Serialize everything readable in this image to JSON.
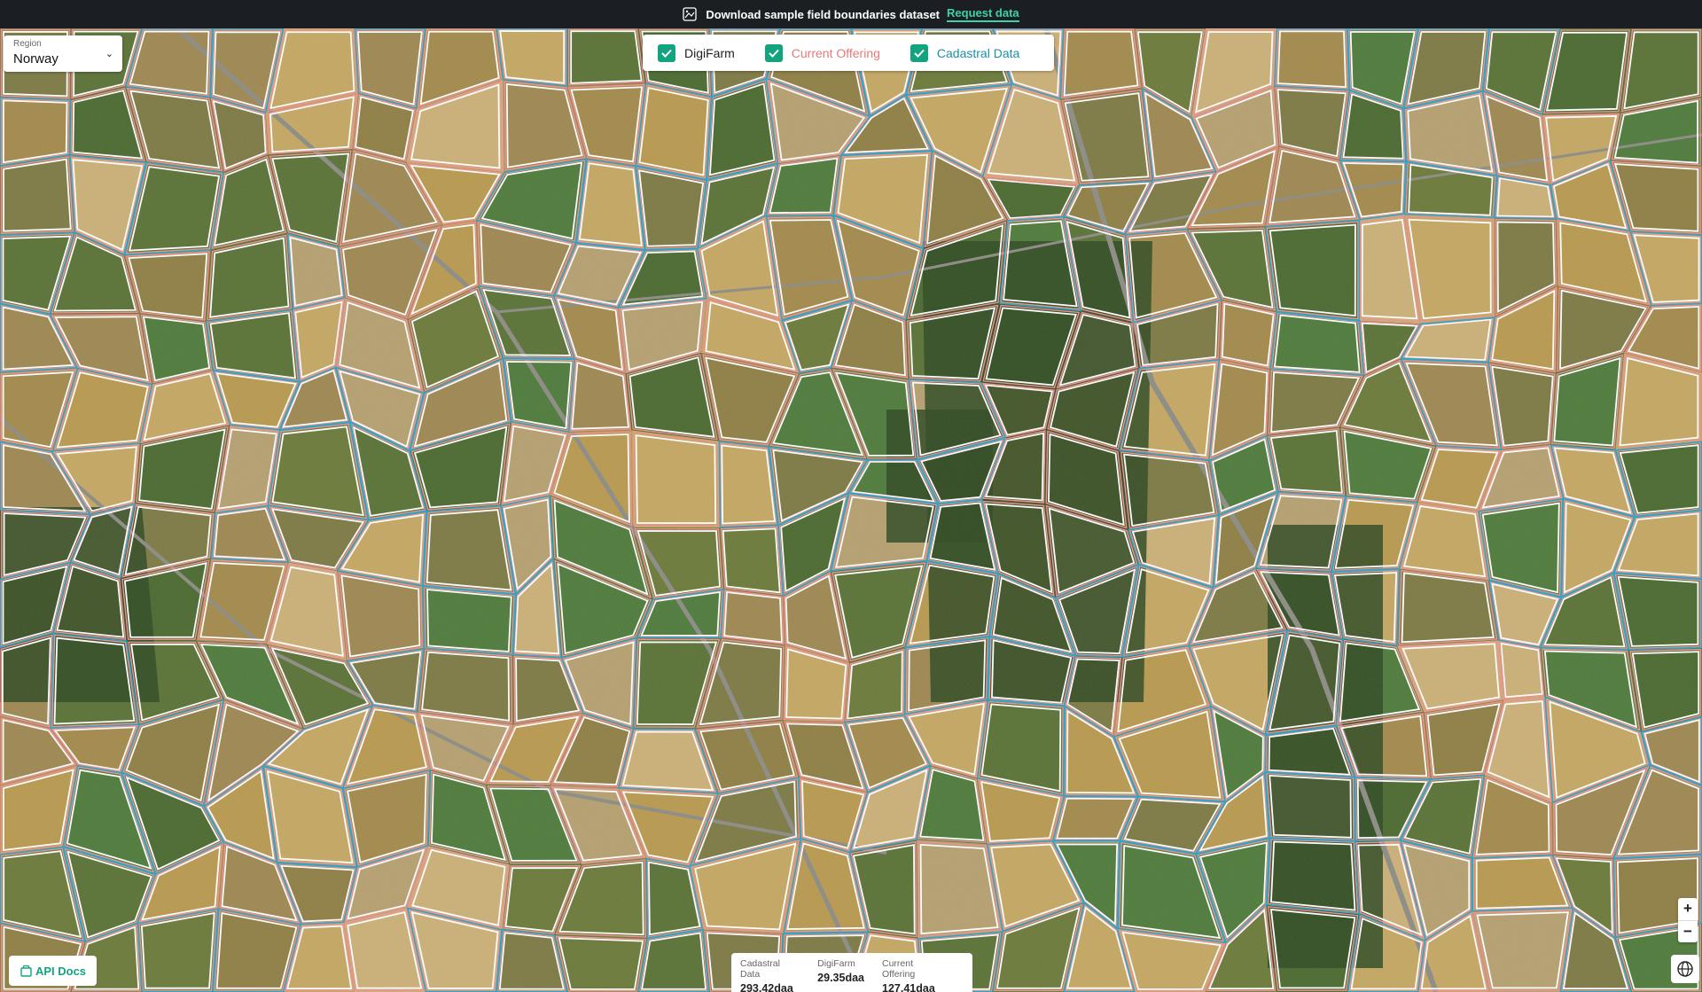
{
  "banner": {
    "text": "Download sample field boundaries dataset",
    "link": "Request data"
  },
  "region": {
    "label": "Region",
    "value": "Norway"
  },
  "layers": [
    {
      "label": "DigiFarm",
      "color": "#1b1f23",
      "checked": true
    },
    {
      "label": "Current Offering",
      "color": "#e87878",
      "checked": true
    },
    {
      "label": "Cadastral Data",
      "color": "#1a8fa8",
      "checked": true
    }
  ],
  "stats": [
    {
      "label": "Cadastral Data",
      "value": "293.42daa"
    },
    {
      "label": "DigiFarm",
      "value": "29.35daa"
    },
    {
      "label": "Current Offering",
      "value": "127.41daa"
    }
  ],
  "api_docs": "API Docs",
  "zoom": {
    "in": "+",
    "out": "−"
  },
  "colors": {
    "accent": "#14a37f",
    "digifarm_line": "#ffffff",
    "offering_line": "#f0908f",
    "cadastral_line": "#2ba3c2"
  }
}
